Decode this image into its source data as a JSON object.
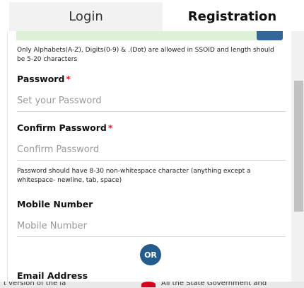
{
  "tabs": [
    {
      "label": "Login"
    },
    {
      "label": "Registration"
    }
  ],
  "ssoid_hint": "Only Alphabets(A-Z), Digits(0-9) & .(Dot) are allowed in SSOID and length should be 5-20 characters",
  "password": {
    "label": "Password",
    "required_mark": "*",
    "placeholder": "Set your Password"
  },
  "confirm_password": {
    "label": "Confirm Password",
    "required_mark": "*",
    "placeholder": "Confirm Password"
  },
  "password_hint": "Password should have 8-30 non-whitespace character (anything except a whitespace- newline, tab, space)",
  "mobile": {
    "label": "Mobile Number",
    "placeholder": "Mobile Number"
  },
  "or_label": "OR",
  "email": {
    "label": "Email Address"
  },
  "footer": {
    "ticker_left": "t version of the la",
    "ticker_right": "All the State Government and"
  },
  "colors": {
    "accent": "#245c8d",
    "required": "#d9232d",
    "success_bar": "#dff0d8"
  }
}
